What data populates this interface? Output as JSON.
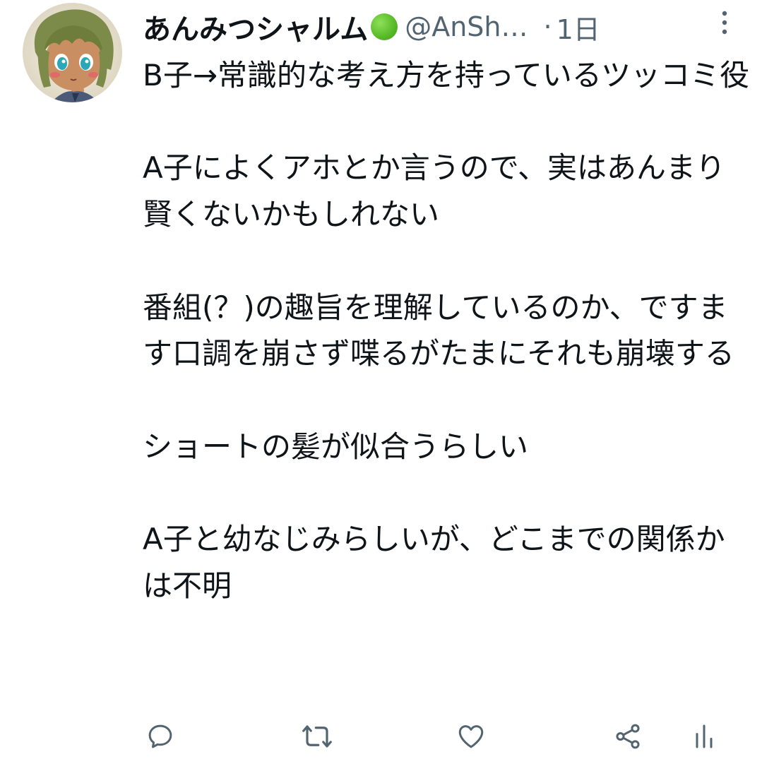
{
  "tweet": {
    "author": {
      "display_name": "あんみつシャルム",
      "status_emoji": "green-circle",
      "handle": "@AnSh…",
      "separator": "·",
      "time": "1日"
    },
    "text": "B子→常識的な考え方を持っているツッコミ役\n\nA子によくアホとか言うので、実はあんまり賢くないかもしれない\n\n番組(？)の趣旨を理解しているのか、ですます口調を崩さず喋るがたまにそれも崩壊する\n\nショートの髪が似合うらしい\n\nA子と幼なじみらしいが、どこまでの関係かは不明",
    "actions": [
      {
        "name": "reply",
        "icon": "speech-bubble-icon"
      },
      {
        "name": "retweet",
        "icon": "retweet-icon"
      },
      {
        "name": "like",
        "icon": "heart-icon"
      },
      {
        "name": "share",
        "icon": "share-icon"
      },
      {
        "name": "analytics",
        "icon": "bar-chart-icon"
      }
    ]
  },
  "colors": {
    "text_primary": "#0f1419",
    "text_secondary": "#536471",
    "icon": "#536471",
    "status_emoji": "#5bbd2a"
  }
}
